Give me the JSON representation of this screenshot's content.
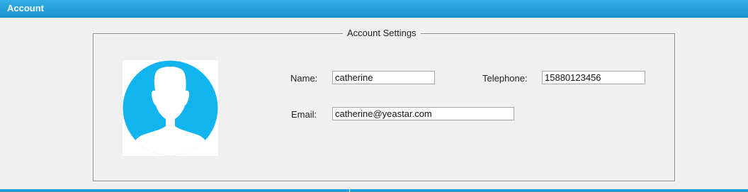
{
  "header": {
    "title": "Account"
  },
  "account_settings": {
    "legend": "Account Settings",
    "avatar_icon": "user-silhouette-icon",
    "fields": {
      "name": {
        "label": "Name:",
        "value": "catherine"
      },
      "telephone": {
        "label": "Telephone:",
        "value": "15880123456"
      },
      "email": {
        "label": "Email:",
        "value": "catherine@yeastar.com"
      }
    }
  },
  "colors": {
    "header": "#1b96d3",
    "avatar": "#12b4ef",
    "background": "#f0f0f0"
  }
}
